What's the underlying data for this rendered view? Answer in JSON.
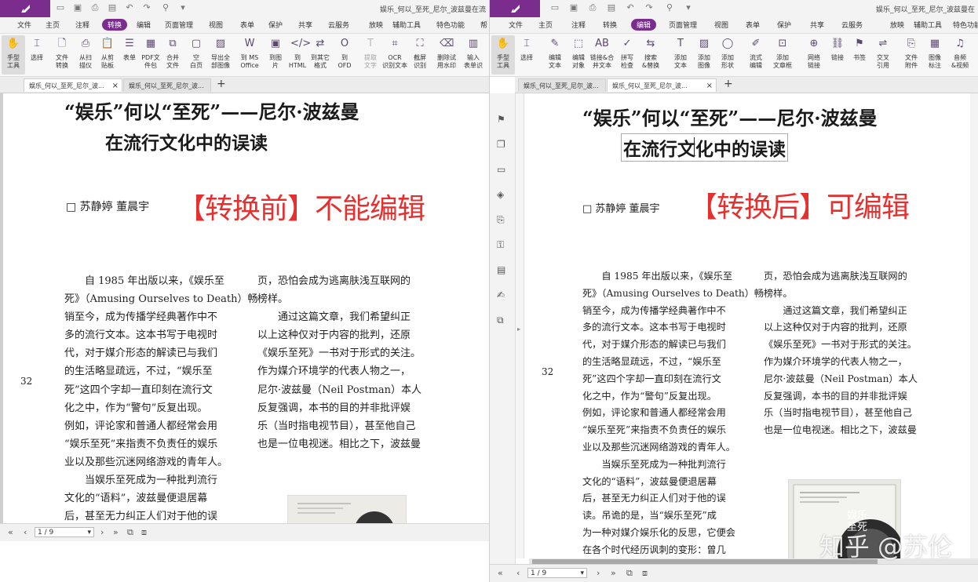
{
  "left_window": {
    "doc_title": "娱乐_何以_至死_尼尔_波兹曼在流",
    "menu": [
      "文件",
      "主页",
      "注释",
      "转换",
      "编辑",
      "页面管理",
      "视图",
      "表单",
      "保护",
      "共享",
      "云服务",
      "放映",
      "辅助工具",
      "特色功能",
      "帮"
    ],
    "active_menu": "转换",
    "tools": [
      {
        "label": "手型\n工具",
        "icon": "hand-icon"
      },
      {
        "label": "选择",
        "icon": "select-icon"
      },
      {
        "label": "文件\n转换",
        "icon": "file-convert-icon"
      },
      {
        "label": "从扫\n描仪",
        "icon": "scanner-icon"
      },
      {
        "label": "从剪\n贴板",
        "icon": "clipboard-icon"
      },
      {
        "label": "表单",
        "icon": "form-icon"
      },
      {
        "label": "PDF文\n件包",
        "icon": "portfolio-icon"
      },
      {
        "label": "合并\n文件",
        "icon": "merge-icon"
      },
      {
        "label": "空\n白页",
        "icon": "blank-page-icon"
      },
      {
        "label": "导出全\n部图像",
        "icon": "export-images-icon"
      },
      {
        "label": "到 MS\nOffice",
        "icon": "to-office-icon"
      },
      {
        "label": "到图\n片",
        "icon": "to-image-icon"
      },
      {
        "label": "到\nHTML",
        "icon": "to-html-icon"
      },
      {
        "label": "到其它\n格式",
        "icon": "to-other-icon"
      },
      {
        "label": "到\nOFD",
        "icon": "to-ofd-icon"
      },
      {
        "label": "提取\n文字",
        "icon": "extract-text-icon"
      },
      {
        "label": "OCR\n识别文本",
        "icon": "ocr-icon"
      },
      {
        "label": "截屏\n识别",
        "icon": "screenshot-ocr-icon"
      },
      {
        "label": "删除试\n用水印",
        "icon": "remove-watermark-icon"
      },
      {
        "label": "输入\n表单识",
        "icon": "form-recognize-icon"
      }
    ],
    "tabs": [
      "娱乐_何以_至死_尼尔_波...",
      "娱乐_何以_至死_尼尔_波..."
    ],
    "label": "【转换前】不能编辑",
    "page_indicator": "1 / 9"
  },
  "right_window": {
    "doc_title": "娱乐_何以_至死_尼尔_波兹曼在",
    "menu": [
      "文件",
      "主页",
      "注释",
      "转换",
      "编辑",
      "页面管理",
      "视图",
      "表单",
      "保护",
      "共享",
      "云服务",
      "放映",
      "辅助工具",
      "特色功能"
    ],
    "active_menu": "编辑",
    "tools": [
      {
        "label": "手型\n工具",
        "icon": "hand-icon"
      },
      {
        "label": "选择",
        "icon": "select-icon"
      },
      {
        "label": "编辑\n文本",
        "icon": "edit-text-icon"
      },
      {
        "label": "编辑\n对象",
        "icon": "edit-object-icon"
      },
      {
        "label": "链接&合\n并文本",
        "icon": "link-merge-text-icon"
      },
      {
        "label": "拼写\n检查",
        "icon": "spell-check-icon"
      },
      {
        "label": "搜索\n&替换",
        "icon": "search-replace-icon"
      },
      {
        "label": "添加\n文本",
        "icon": "add-text-icon"
      },
      {
        "label": "添加\n图像",
        "icon": "add-image-icon"
      },
      {
        "label": "添加\n形状",
        "icon": "add-shape-icon"
      },
      {
        "label": "流式\n编辑",
        "icon": "flow-edit-icon"
      },
      {
        "label": "添加\n文章框",
        "icon": "article-box-icon"
      },
      {
        "label": "网络\n链接",
        "icon": "web-link-icon"
      },
      {
        "label": "链接",
        "icon": "link-icon"
      },
      {
        "label": "书签",
        "icon": "bookmark-icon"
      },
      {
        "label": "交叉\n引用",
        "icon": "cross-ref-icon"
      },
      {
        "label": "文件\n附件",
        "icon": "attachment-icon"
      },
      {
        "label": "图像\n标注",
        "icon": "image-annotation-icon"
      },
      {
        "label": "音频\n&视频",
        "icon": "audio-video-icon"
      }
    ],
    "tabs": [
      "娱乐_何以_至死_尼尔_波...",
      "娱乐_何以_至死_尼尔_波..."
    ],
    "label": "【转换后】可编辑",
    "page_indicator": "1 / 9",
    "sidebar_icons": [
      "bookmark-icon",
      "pages-icon",
      "comment-icon",
      "layers-icon",
      "attachment-icon",
      "security-icon",
      "fields-icon",
      "signature-icon",
      "compare-icon"
    ]
  },
  "document": {
    "title_line1": "“娱乐”何以“至死”——尼尔·波兹曼",
    "title_line2": "在流行文化中的误读",
    "authors": "□  苏静婷    董晨宇",
    "page_number": "32",
    "left_col_lines": [
      "　　自 1985 年出版以来，《娱乐至",
      "死》（Amusing Ourselves to Death）畅",
      "销至今，成为传播学经典著作中不",
      "多的流行文本。这本书写于电视时",
      "代，对于媒介形态的解读已与我们",
      "的生活略显疏远，不过，“娱乐至",
      "死”这四个字却一直印刻在流行文",
      "化之中，作为“警句”反复出现。",
      "例如，评论家和普通人都经常会用",
      "“娱乐至死”来指责不负责任的娱乐",
      "业以及那些沉迷网络游戏的青年人。",
      "　　当娱乐至死成为一种批判流行",
      "文化的“语料”，波兹曼便退居幕",
      "后，甚至无力纠正人们对于他的误",
      "读。吊诡的是，当“娱乐至死”成",
      "为一种对媒介娱乐化的反思，它便会",
      "在各个时代经历讽刺的变形：曾几"
    ],
    "right_col_lines": [
      "页，恐怕会成为逃离肤浅互联网的",
      "榜样。",
      "　　通过这篇文章，我们希望纠正",
      "以上这种仅对于内容的批判，还原",
      "《娱乐至死》一书对于形式的关注。",
      "作为媒介环境学的代表人物之一，",
      "尼尔·波兹曼（Neil Postman）本人",
      "反复强调，本书的目的并非批评娱",
      "乐（当时指电视节目），甚至他自己",
      "也是一位电视迷。相比之下，波兹曼"
    ],
    "book_cover_text": "娱乐\n至死"
  },
  "watermark": "知乎 @苏伦",
  "colors": {
    "brand": "#7b2d8e",
    "label_red": "#e53030"
  }
}
